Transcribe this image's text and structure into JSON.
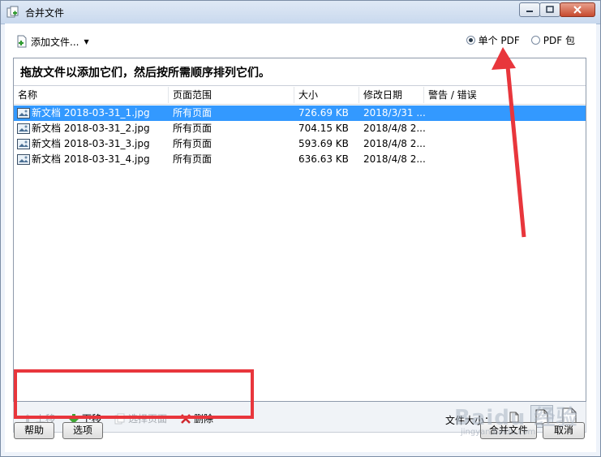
{
  "window": {
    "title": "合并文件"
  },
  "toolbar": {
    "add_files_label": "添加文件...",
    "output_options": [
      {
        "label": "单个 PDF",
        "selected": true
      },
      {
        "label": "PDF 包",
        "selected": false
      }
    ]
  },
  "panel": {
    "instruction": "拖放文件以添加它们，然后按所需顺序排列它们。"
  },
  "table": {
    "columns": [
      "名称",
      "页面范围",
      "大小",
      "修改日期",
      "警告 / 错误"
    ],
    "rows": [
      {
        "name": "新文档 2018-03-31_1.jpg",
        "range": "所有页面",
        "size": "726.69 KB",
        "modified": "2018/3/31 ...",
        "warning": "",
        "selected": true
      },
      {
        "name": "新文档 2018-03-31_2.jpg",
        "range": "所有页面",
        "size": "704.15 KB",
        "modified": "2018/4/8 2...",
        "warning": "",
        "selected": false
      },
      {
        "name": "新文档 2018-03-31_3.jpg",
        "range": "所有页面",
        "size": "593.69 KB",
        "modified": "2018/4/8 2...",
        "warning": "",
        "selected": false
      },
      {
        "name": "新文档 2018-03-31_4.jpg",
        "range": "所有页面",
        "size": "636.63 KB",
        "modified": "2018/4/8 2...",
        "warning": "",
        "selected": false
      }
    ]
  },
  "actions": {
    "move_up": "上移",
    "move_down": "下移",
    "select_pages": "选择页面",
    "delete": "删除",
    "file_size_label": "文件大小："
  },
  "footer": {
    "help": "帮助",
    "options": "选项",
    "combine": "合并文件",
    "cancel": "取消"
  },
  "watermark": {
    "text": "Baidu 经验",
    "sub": "jingyan.baidu.com"
  },
  "colors": {
    "selection": "#3399ff",
    "annotation_red": "#e8363c"
  }
}
